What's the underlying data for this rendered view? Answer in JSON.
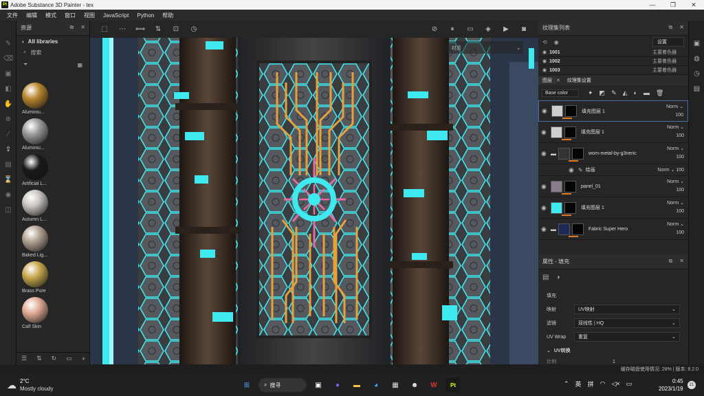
{
  "titlebar": {
    "app_icon": "Pt",
    "title": "Adobe Substance 3D Painter - tex"
  },
  "menu": [
    "文件",
    "编辑",
    "模式",
    "窗口",
    "视图",
    "JavaScript",
    "Python",
    "帮助"
  ],
  "assets": {
    "title": "资源",
    "library": "All libraries",
    "search_placeholder": "搜索",
    "materials": [
      {
        "name": "Aluminiu...",
        "color": "#b8862e"
      },
      {
        "name": "Aluminiu...",
        "color": "#9a9a9a"
      },
      {
        "name": "Artificial L...",
        "color": "#1a1a1a"
      },
      {
        "name": "Autumn L...",
        "color": "#c9c4bf"
      },
      {
        "name": "Baked Lig...",
        "color": "#b0a290"
      },
      {
        "name": "Brass Pure",
        "color": "#c8a84e"
      },
      {
        "name": "Calf Skin",
        "color": "#e0aa96"
      }
    ]
  },
  "viewport": {
    "mode_label": "材质"
  },
  "texture_sets": {
    "title": "纹理集列表",
    "settings": "设置",
    "rows": [
      {
        "id": "1001",
        "shader": "主要着色器"
      },
      {
        "id": "1002",
        "shader": "主要着色器"
      },
      {
        "id": "1003",
        "shader": "主要着色器"
      }
    ]
  },
  "layers": {
    "tab_layers": "图层",
    "tab_settings": "纹理集设置",
    "channel": "Base color",
    "rows": [
      {
        "name": "填充图层 1",
        "blend": "Norm",
        "opacity": "100",
        "thumb": "#cfcfcf",
        "mask": "#050505"
      },
      {
        "name": "填充图层 1",
        "blend": "Norm",
        "opacity": "100",
        "thumb": "#cfcfcf",
        "mask": "#050505"
      },
      {
        "name": "worn-metal-by-g3neric",
        "blend": "Norm",
        "opacity": "100",
        "thumb": "#333",
        "mask": "#050505"
      },
      {
        "name": "绘画",
        "blend": "Norm",
        "opacity": "100",
        "thumb": "",
        "mask": ""
      },
      {
        "name": "panel_01",
        "blend": "Norm",
        "opacity": "100",
        "thumb": "#8a7c8c",
        "mask": "#050505"
      },
      {
        "name": "填充图层 1",
        "blend": "Norm",
        "opacity": "100",
        "thumb": "#3ee9ef",
        "mask": "#050505"
      },
      {
        "name": "Fabric Super Hero",
        "blend": "Norm",
        "opacity": "100",
        "thumb": "#1d2a55",
        "mask": "#050505"
      }
    ]
  },
  "properties": {
    "title": "属性 - 填充",
    "section": "填充",
    "mapping_label": "映射",
    "mapping_value": "UV映射",
    "filter_label": "滤镜",
    "filter_value": "双线性 | HQ",
    "wrap_label": "UV Wrap",
    "wrap_value": "重复",
    "uv_transform": "UV转换",
    "scale_label": "比例",
    "scale_value": "1"
  },
  "status": {
    "text": "缓存磁盘使用情况:  28% | 版本:  8.2.0"
  },
  "taskbar": {
    "weather_temp": "2°C",
    "weather_text": "Mostly cloudy",
    "search": "搜寻",
    "ime1": "英",
    "ime2": "拼",
    "time": "0:45",
    "date": "2023/1/19",
    "badge": "21"
  },
  "colors": {
    "cyan": "#3ee9ef",
    "orange": "#e8a03a",
    "pink": "#e86aa0",
    "accent": "#e07b20"
  }
}
